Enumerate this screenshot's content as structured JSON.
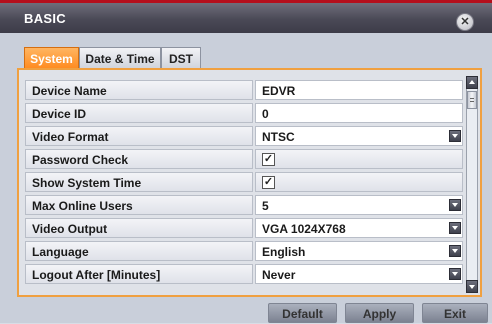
{
  "window": {
    "title": "BASIC"
  },
  "tabs": [
    {
      "label": "System",
      "active": true
    },
    {
      "label": "Date & Time",
      "active": false
    },
    {
      "label": "DST",
      "active": false
    }
  ],
  "settings": [
    {
      "label": "Device Name",
      "value": "EDVR",
      "control": "text"
    },
    {
      "label": "Device ID",
      "value": "0",
      "control": "text"
    },
    {
      "label": "Video Format",
      "value": "NTSC",
      "control": "dropdown"
    },
    {
      "label": "Password Check",
      "value": "✓",
      "control": "checkbox",
      "checked": true
    },
    {
      "label": "Show System Time",
      "value": "✓",
      "control": "checkbox",
      "checked": true
    },
    {
      "label": "Max Online Users",
      "value": "5",
      "control": "dropdown"
    },
    {
      "label": "Video Output",
      "value": "VGA 1024X768",
      "control": "dropdown"
    },
    {
      "label": "Language",
      "value": "English",
      "control": "dropdown"
    },
    {
      "label": "Logout After [Minutes]",
      "value": "Never",
      "control": "dropdown"
    }
  ],
  "buttons": {
    "default": "Default",
    "apply": "Apply",
    "exit": "Exit"
  },
  "colors": {
    "accent": "#ff8a1e",
    "title_bar": "#4a4956",
    "panel_border": "#f0a040"
  },
  "icons": {
    "close": "close-icon",
    "dropdown": "chevron-down-icon",
    "scroll_up": "arrow-up-icon",
    "scroll_down": "arrow-down-icon"
  }
}
